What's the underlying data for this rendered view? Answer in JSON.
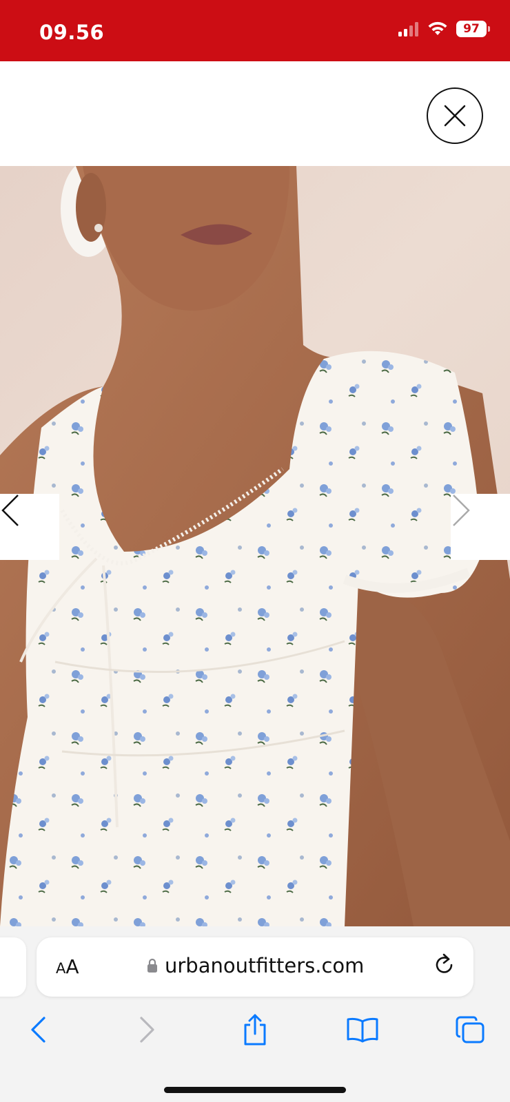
{
  "status_bar": {
    "time": "09.56",
    "battery": "97",
    "background_color": "#cc0d14",
    "icons": [
      "cellular-signal-icon",
      "wifi-icon",
      "battery-icon"
    ]
  },
  "modal": {
    "close_icon": "close-icon"
  },
  "gallery": {
    "image_alt": "Model wearing white floral print puff sleeve dress",
    "prev_icon": "chevron-left-icon",
    "next_icon": "chevron-right-icon"
  },
  "browser": {
    "aa_label_small": "A",
    "aa_label_large": "A",
    "url": "urbanoutfitters.com",
    "lock_icon": "lock-icon",
    "reload_icon": "reload-icon",
    "toolbar": [
      "back-icon",
      "forward-icon",
      "share-icon",
      "bookmarks-icon",
      "tabs-icon"
    ],
    "accent_color": "#0a7aff"
  }
}
